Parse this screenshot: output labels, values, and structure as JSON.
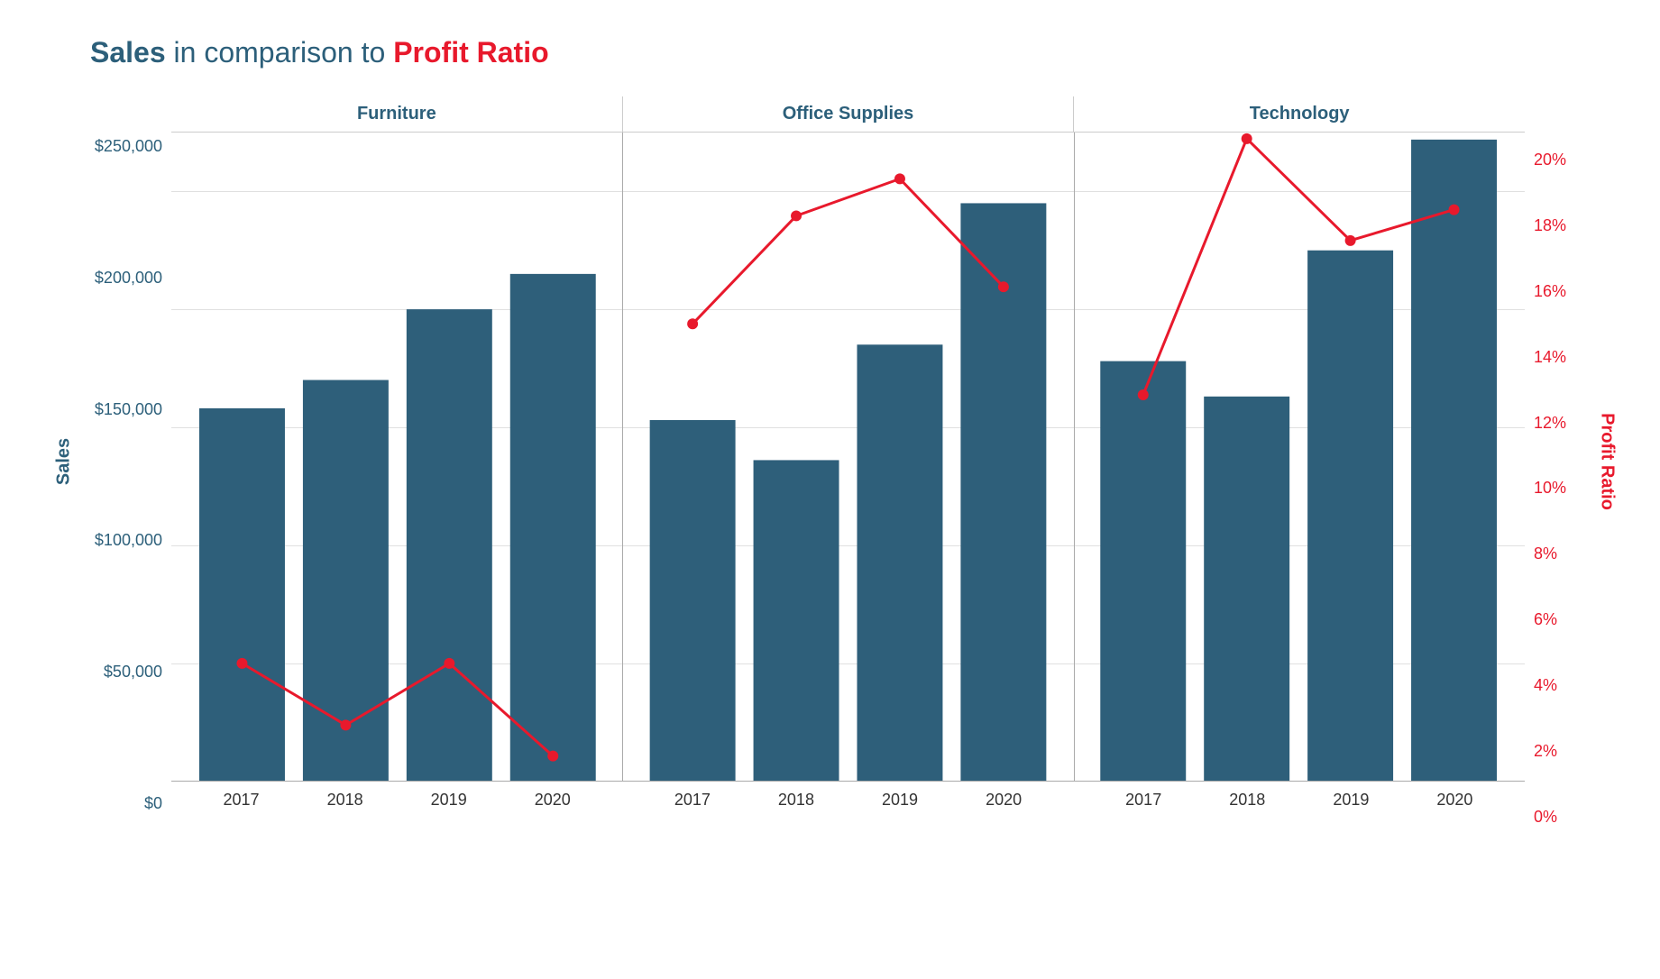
{
  "title": {
    "prefix": "Sales",
    "middle": " in comparison to ",
    "suffix": "Profit Ratio"
  },
  "yAxisLeft": {
    "label": "Sales",
    "ticks": [
      "$250,000",
      "$200,000",
      "$150,000",
      "$100,000",
      "$50,000",
      "$0"
    ]
  },
  "yAxisRight": {
    "label": "Profit Ratio",
    "ticks": [
      "20%",
      "18%",
      "16%",
      "14%",
      "12%",
      "10%",
      "8%",
      "6%",
      "4%",
      "2%",
      "0%"
    ]
  },
  "categories": [
    {
      "name": "Furniture",
      "years": [
        2017,
        2018,
        2019,
        2020
      ],
      "sales": [
        158000,
        170000,
        200000,
        215000
      ],
      "profitRatio": [
        3.8,
        1.8,
        3.8,
        0.8
      ]
    },
    {
      "name": "Office Supplies",
      "years": [
        2017,
        2018,
        2019,
        2020
      ],
      "sales": [
        153000,
        136000,
        185000,
        245000
      ],
      "profitRatio": [
        14.8,
        18.3,
        19.5,
        16.0
      ]
    },
    {
      "name": "Technology",
      "years": [
        2017,
        2018,
        2019,
        2020
      ],
      "sales": [
        178000,
        163000,
        225000,
        272000
      ],
      "profitRatio": [
        12.5,
        20.8,
        17.5,
        18.5
      ]
    }
  ],
  "colors": {
    "bar": "#2e5f7a",
    "line": "#e8192c",
    "titleBlue": "#2c5f7a",
    "titleRed": "#e8192c"
  }
}
